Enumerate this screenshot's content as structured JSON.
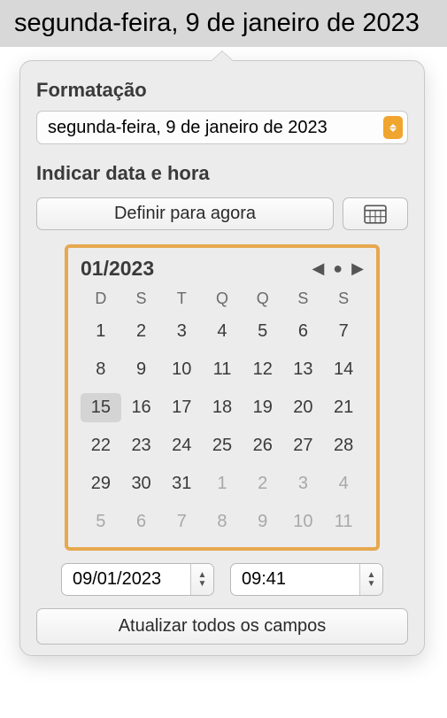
{
  "title": "segunda-feira, 9 de janeiro de 2023",
  "format_section": {
    "label": "Formatação",
    "selected": "segunda-feira, 9 de janeiro de 2023"
  },
  "datetime_section": {
    "label": "Indicar data e hora",
    "set_now_label": "Definir para agora"
  },
  "calendar": {
    "month_label": "01/2023",
    "dow": [
      "D",
      "S",
      "T",
      "Q",
      "Q",
      "S",
      "S"
    ],
    "weeks": [
      [
        {
          "d": "1"
        },
        {
          "d": "2"
        },
        {
          "d": "3"
        },
        {
          "d": "4"
        },
        {
          "d": "5"
        },
        {
          "d": "6"
        },
        {
          "d": "7"
        }
      ],
      [
        {
          "d": "8"
        },
        {
          "d": "9"
        },
        {
          "d": "10"
        },
        {
          "d": "11"
        },
        {
          "d": "12"
        },
        {
          "d": "13"
        },
        {
          "d": "14"
        }
      ],
      [
        {
          "d": "15",
          "sel": true
        },
        {
          "d": "16"
        },
        {
          "d": "17"
        },
        {
          "d": "18"
        },
        {
          "d": "19"
        },
        {
          "d": "20"
        },
        {
          "d": "21"
        }
      ],
      [
        {
          "d": "22"
        },
        {
          "d": "23"
        },
        {
          "d": "24"
        },
        {
          "d": "25"
        },
        {
          "d": "26"
        },
        {
          "d": "27"
        },
        {
          "d": "28"
        }
      ],
      [
        {
          "d": "29"
        },
        {
          "d": "30"
        },
        {
          "d": "31"
        },
        {
          "d": "1",
          "dim": true
        },
        {
          "d": "2",
          "dim": true
        },
        {
          "d": "3",
          "dim": true
        },
        {
          "d": "4",
          "dim": true
        }
      ],
      [
        {
          "d": "5",
          "dim": true
        },
        {
          "d": "6",
          "dim": true
        },
        {
          "d": "7",
          "dim": true
        },
        {
          "d": "8",
          "dim": true
        },
        {
          "d": "9",
          "dim": true
        },
        {
          "d": "10",
          "dim": true
        },
        {
          "d": "11",
          "dim": true
        }
      ]
    ]
  },
  "date_field": "09/01/2023",
  "time_field": "09:41",
  "update_label": "Atualizar todos os campos"
}
